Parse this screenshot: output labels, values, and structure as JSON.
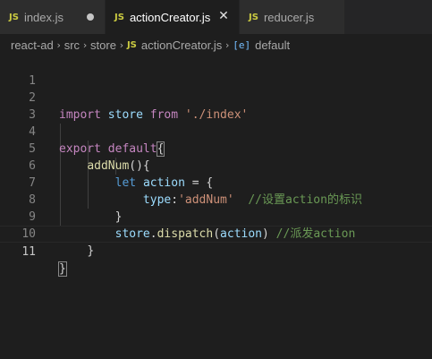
{
  "tabs": [
    {
      "label": "index.js",
      "badge": "JS",
      "state": "modified"
    },
    {
      "label": "actionCreator.js",
      "badge": "JS",
      "state": "active"
    },
    {
      "label": "reducer.js",
      "badge": "JS",
      "state": "normal"
    }
  ],
  "breadcrumb": {
    "items": [
      "react-ad",
      "src",
      "store"
    ],
    "file_badge": "JS",
    "file": "actionCreator.js",
    "symbol": "default",
    "symbol_icon": "[e]"
  },
  "editor": {
    "line_numbers": [
      "1",
      "2",
      "3",
      "4",
      "5",
      "6",
      "7",
      "8",
      "9",
      "10",
      "11"
    ],
    "lines": {
      "l2": {
        "kw_import": "import",
        "name": "store",
        "kw_from": "from",
        "path": "'./index'"
      },
      "l4": {
        "kw_export": "export",
        "kw_default": "default",
        "brace": "{"
      },
      "l5": {
        "fn": "addNum",
        "rest": "(){"
      },
      "l6": {
        "kw_let": "let",
        "var": "action",
        "rest": " = {"
      },
      "l7": {
        "prop": "type",
        "colon": ":",
        "value": "'addNum'",
        "comment": "//设置action的标识"
      },
      "l8": {
        "text": "}"
      },
      "l9": {
        "obj": "store",
        "dot": ".",
        "method": "dispatch",
        "open": "(",
        "arg": "action",
        "close": ")",
        "comment": "//派发action"
      },
      "l10": {
        "text": "}"
      },
      "l11": {
        "text": "}"
      }
    }
  },
  "colors": {
    "background": "#1e1e1e",
    "keyword_purple": "#c586c0",
    "keyword_blue": "#569cd6",
    "variable": "#9cdcfe",
    "function": "#dcdcaa",
    "string": "#ce9178",
    "comment": "#6a9955",
    "js_badge": "#cbcb41"
  }
}
